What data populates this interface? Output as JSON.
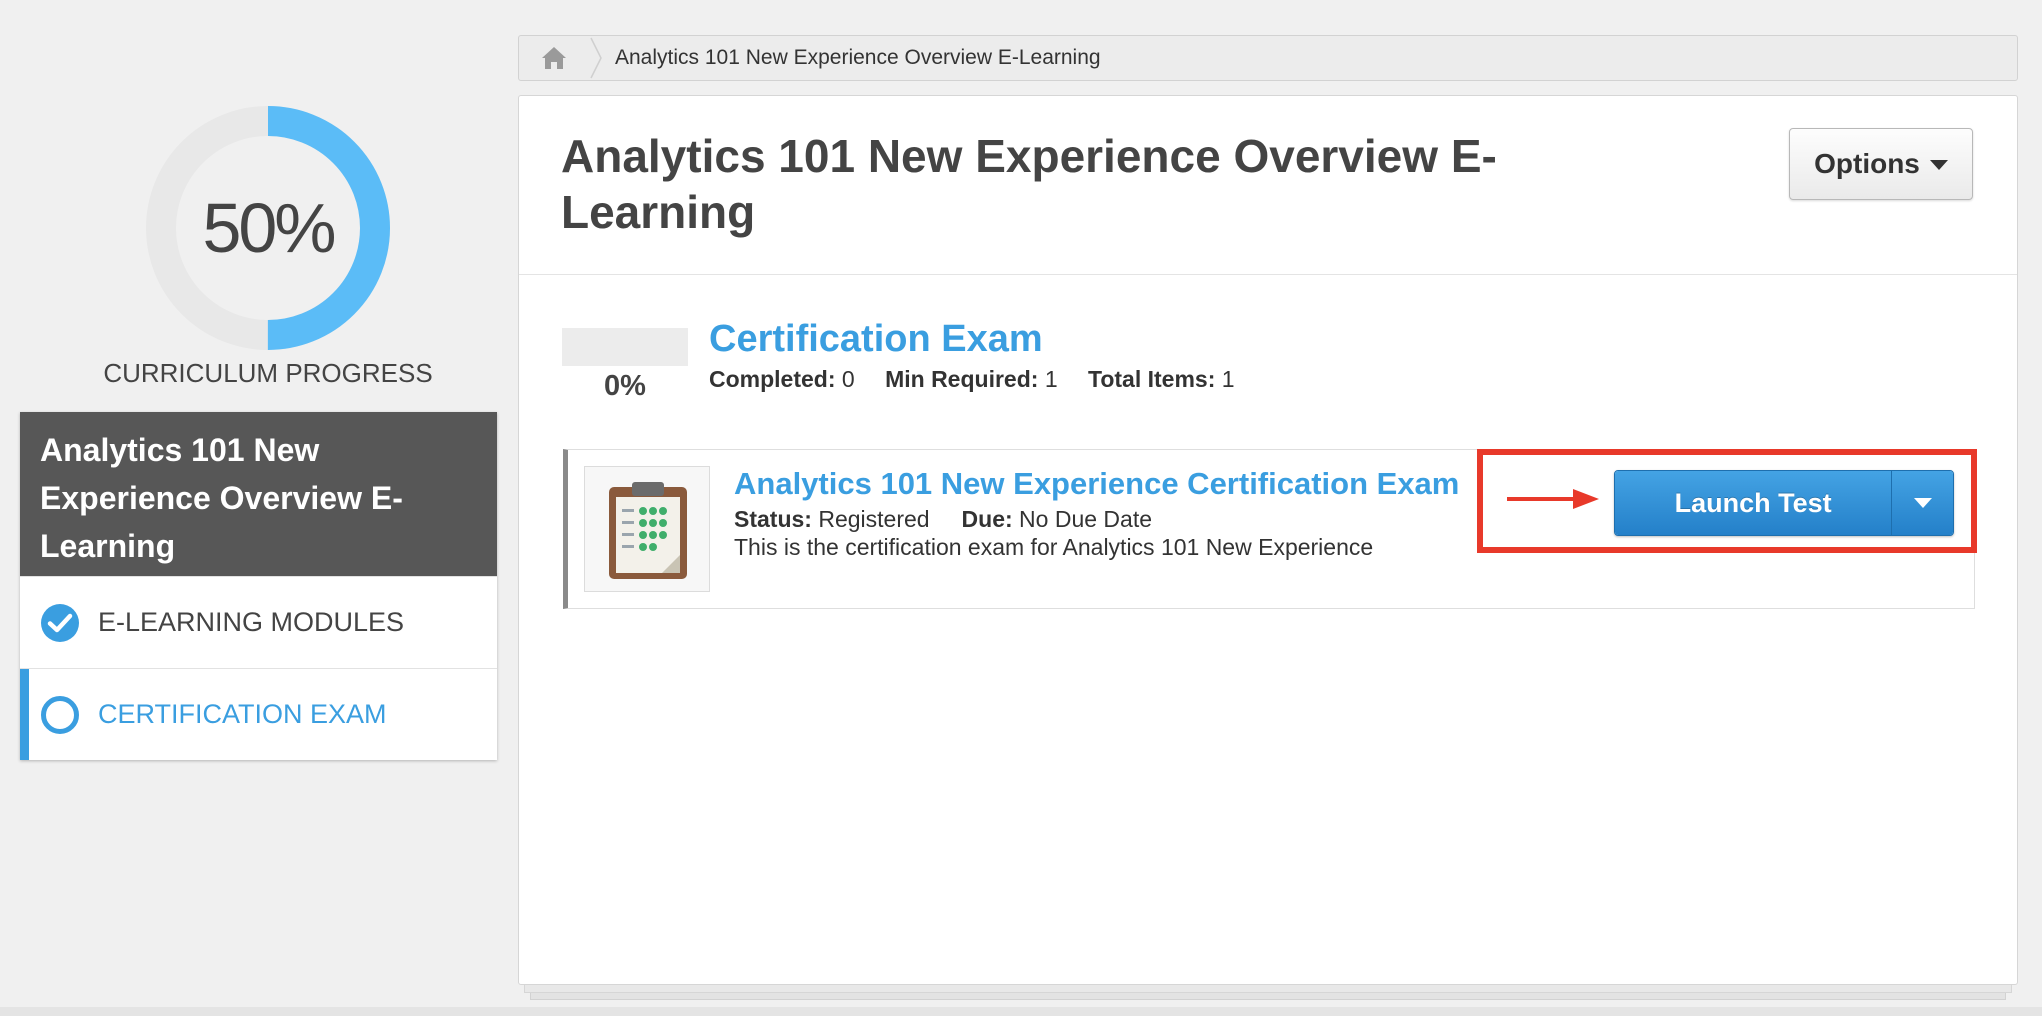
{
  "progress": {
    "percent_label": "50%",
    "fraction": 0.5,
    "label": "CURRICULUM PROGRESS",
    "colors": {
      "fill": "#5bbcf7",
      "track": "#e8e8e8"
    }
  },
  "sidebar": {
    "title": "Analytics 101 New Experience Overview E-Learning",
    "items": [
      {
        "label": "E-LEARNING MODULES",
        "state": "completed",
        "icon": "check-circle-icon"
      },
      {
        "label": "CERTIFICATION EXAM",
        "state": "active",
        "icon": "empty-circle-icon"
      }
    ]
  },
  "breadcrumb": {
    "home_icon": "home-icon",
    "current": "Analytics 101 New Experience Overview E-Learning"
  },
  "main": {
    "title": "Analytics 101 New Experience Overview E-Learning",
    "options_label": "Options",
    "section": {
      "progress_label": "0%",
      "progress_fraction": 0,
      "title": "Certification Exam",
      "completed_label": "Completed:",
      "completed_value": "0",
      "min_required_label": "Min Required:",
      "min_required_value": "1",
      "total_items_label": "Total Items:",
      "total_items_value": "1"
    },
    "exam": {
      "icon": "clipboard-icon",
      "title": "Analytics 101 New Experience Certification Exam",
      "status_label": "Status:",
      "status_value": "Registered",
      "due_label": "Due:",
      "due_value": "No Due Date",
      "description": "This is the certification exam for Analytics 101 New Experience",
      "launch_label": "Launch Test"
    }
  },
  "colors": {
    "accent": "#3a9ee0",
    "highlight": "#e8392a",
    "sidebar_header": "#575757"
  }
}
